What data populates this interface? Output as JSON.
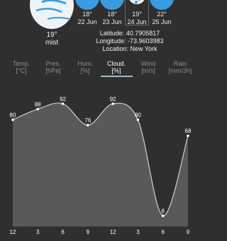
{
  "current": {
    "temp": "19°",
    "desc": "mist",
    "icon": "mist-cloud-icon"
  },
  "forecast": [
    {
      "temp": "18°",
      "date": "22 Jun",
      "icon": "cloud-rain-icon",
      "selected": false
    },
    {
      "temp": "18°",
      "date": "23 Jun",
      "icon": "cloud-rain-icon",
      "selected": false
    },
    {
      "temp": "19°",
      "date": "24 Jun",
      "icon": "cloud-sun-icon",
      "selected": true
    },
    {
      "temp": "22°",
      "date": "25 Jun",
      "icon": "cloud-rain-icon",
      "selected": false
    }
  ],
  "location": {
    "latitude": "Latitude: 40.7905817",
    "longitude": "Longitude: -73.9603983",
    "name": "Location: New York"
  },
  "tabs": [
    {
      "label": "Temp.",
      "unit": "[°C]",
      "active": false
    },
    {
      "label": "Pres.",
      "unit": "[hPa]",
      "active": false
    },
    {
      "label": "Hum.",
      "unit": "[%]",
      "active": false
    },
    {
      "label": "Cloud.",
      "unit": "[%]",
      "active": true
    },
    {
      "label": "Wind",
      "unit": "[m/s]",
      "active": false
    },
    {
      "label": "Rain",
      "unit": "[mm/3h]",
      "active": false
    }
  ],
  "colors": {
    "background": "#2f2f2f",
    "accent": "#9cc0c8",
    "icon_blue": "#3a9be0",
    "area_fill": "#595959",
    "line": "#cfcfcf"
  },
  "chart_data": {
    "type": "area",
    "x": [
      "12",
      "3",
      "6",
      "9",
      "12",
      "3",
      "6",
      "9"
    ],
    "values": [
      80,
      88,
      92,
      76,
      92,
      80,
      8,
      68
    ],
    "ylim": [
      0,
      100
    ],
    "grid": false,
    "title": "",
    "xlabel": "",
    "ylabel": ""
  }
}
